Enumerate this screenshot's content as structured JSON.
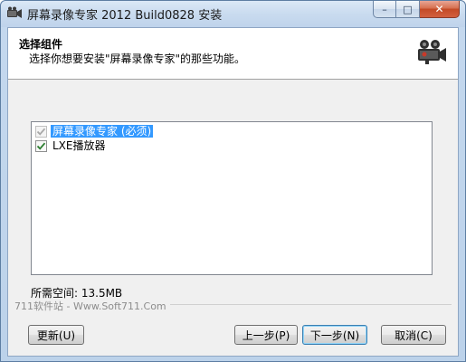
{
  "window": {
    "title": "屏幕录像专家 2012 Build0828 安装",
    "controls": {
      "minimize": "–",
      "maximize": "□",
      "close": "✕"
    }
  },
  "header": {
    "title": "选择组件",
    "subtitle": "选择你想要安装\"屏幕录像专家\"的那些功能。",
    "icon": "video-camera-icon"
  },
  "components": [
    {
      "label": "屏幕录像专家 (必须)",
      "checked": true,
      "disabled": true,
      "selected": true
    },
    {
      "label": "LXE播放器",
      "checked": true,
      "disabled": false,
      "selected": false
    }
  ],
  "space_required": "所需空间: 13.5MB",
  "branding": "711软件站 - Www.Soft711.Com",
  "buttons": {
    "refresh": "更新(U)",
    "back": "上一步(P)",
    "next": "下一步(N)",
    "cancel": "取消(C)"
  },
  "colors": {
    "selection": "#3399ff",
    "check_green": "#2a7d2e",
    "check_disabled": "#a8a8a8"
  }
}
